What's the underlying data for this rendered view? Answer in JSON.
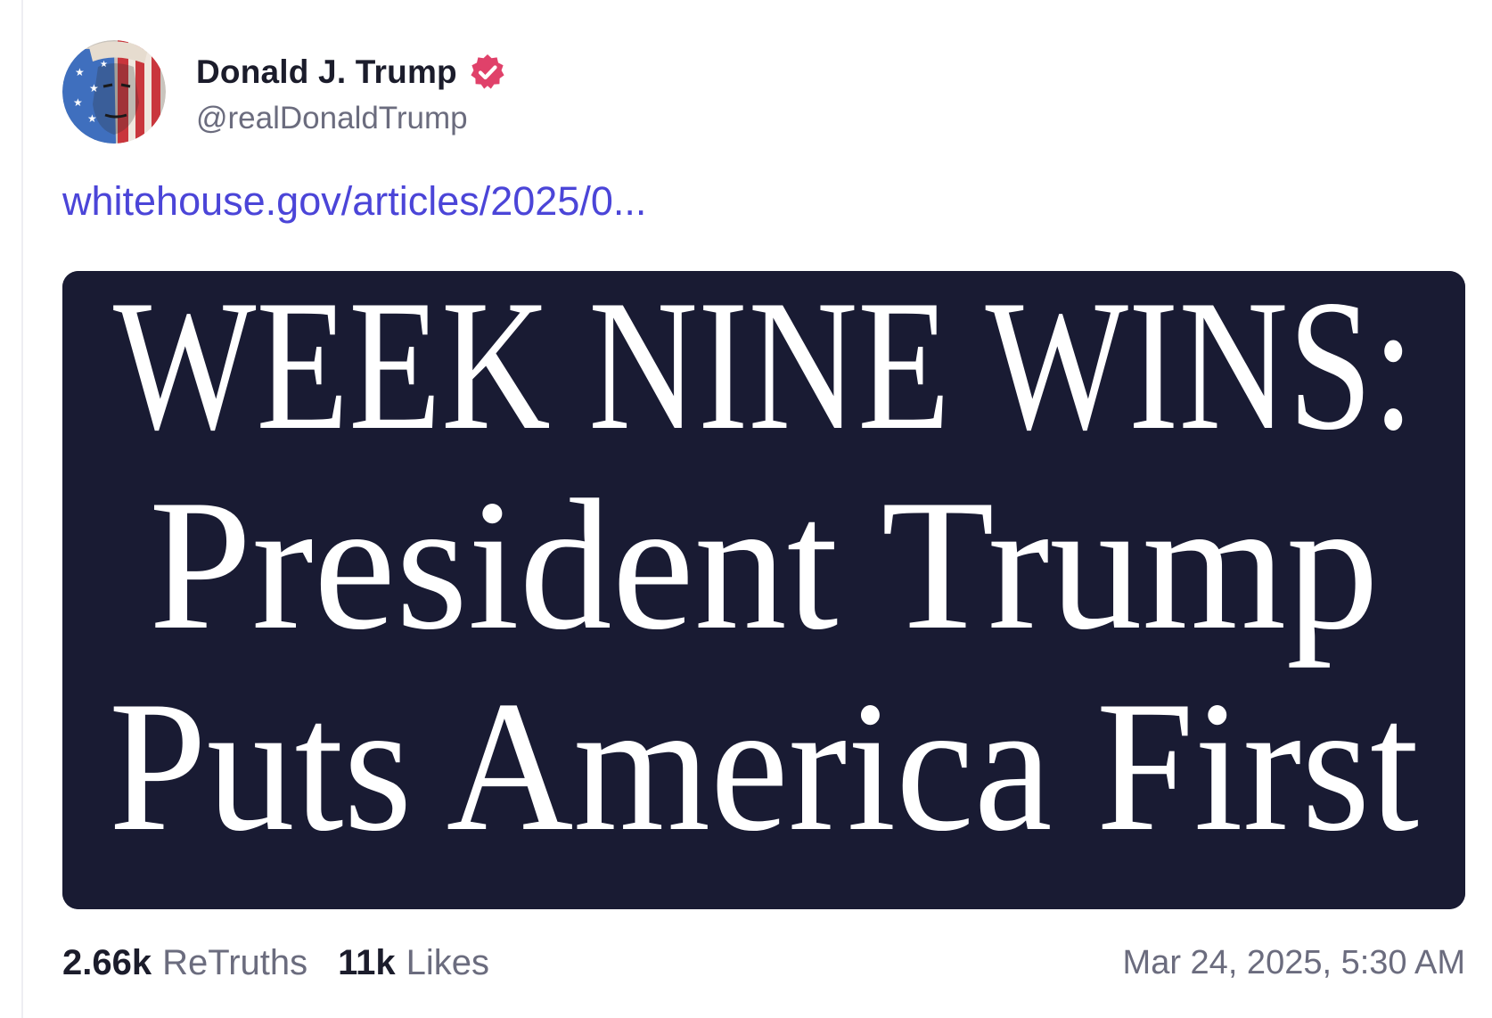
{
  "post": {
    "author": {
      "name": "Donald J. Trump",
      "handle": "@realDonaldTrump",
      "verified": true,
      "verified_color": "#e0416a",
      "avatar_icon": "flag-portrait-avatar"
    },
    "link": {
      "text": "whitehouse.gov/articles/2025/0..."
    },
    "media": {
      "background_color": "#191b33",
      "text_color": "#ffffff",
      "lines": [
        "WEEK NINE WINS:",
        "President Trump",
        "Puts America First"
      ]
    },
    "stats": {
      "retruths_count": "2.66k",
      "retruths_label": "ReTruths",
      "likes_count": "11k",
      "likes_label": "Likes"
    },
    "timestamp": "Mar 24, 2025, 5:30 AM",
    "colors": {
      "link": "#4b45d8",
      "primary_text": "#1b1c2b",
      "secondary_text": "#6b6c7e"
    }
  }
}
